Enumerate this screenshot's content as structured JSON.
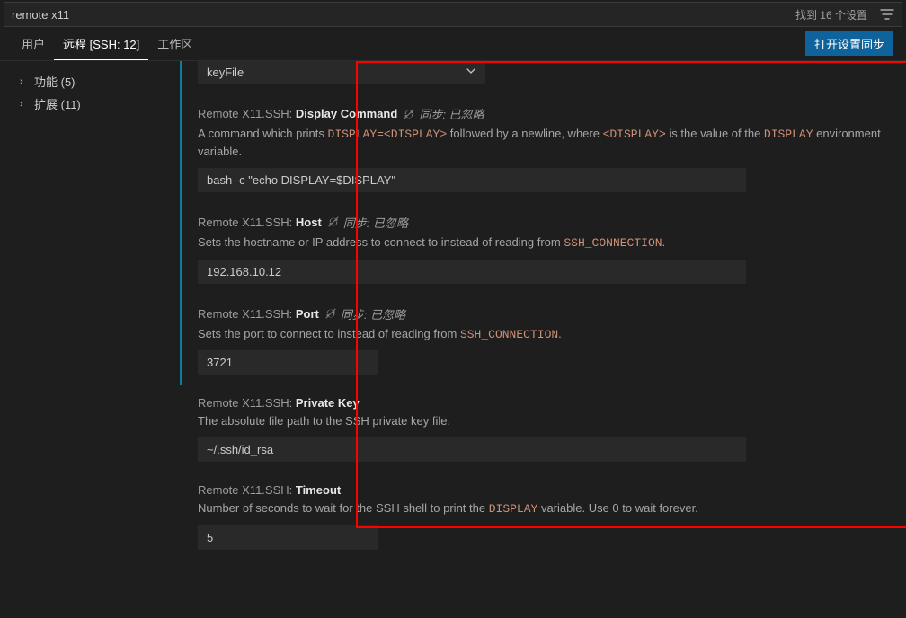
{
  "search": {
    "value": "remote x11",
    "count_text": "找到 16 个设置"
  },
  "tabs": {
    "user": "用户",
    "remote": "远程 [SSH: 12]",
    "workspace": "工作区"
  },
  "sync_button": "打开设置同步",
  "sidebar": {
    "items": [
      {
        "label": "功能 (5)"
      },
      {
        "label": "扩展 (11)"
      }
    ]
  },
  "sync_ignored_label": "同步: 已忽略",
  "settings": {
    "top_select_value": "keyFile",
    "display_command": {
      "prefix": "Remote X11.SSH:",
      "name": "Display Command",
      "desc_a": "A command which prints ",
      "code_a": "DISPLAY=<DISPLAY>",
      "desc_b": " followed by a newline, where ",
      "code_b": "<DISPLAY>",
      "desc_c": " is the value of the ",
      "code_c": "DISPLAY",
      "desc_d": " environment variable.",
      "value": "bash -c \"echo DISPLAY=$DISPLAY\""
    },
    "host": {
      "prefix": "Remote X11.SSH:",
      "name": "Host",
      "desc_a": "Sets the hostname or IP address to connect to instead of reading from ",
      "code_a": "SSH_CONNECTION",
      "desc_b": ".",
      "value": "192.168.10.12"
    },
    "port": {
      "prefix": "Remote X11.SSH:",
      "name": "Port",
      "desc_a": "Sets the port to connect to instead of reading from ",
      "code_a": "SSH_CONNECTION",
      "desc_b": ".",
      "value": "3721"
    },
    "private_key": {
      "prefix": "Remote X11.SSH:",
      "name": "Private Key",
      "desc": "The absolute file path to the SSH private key file.",
      "value": "~/.ssh/id_rsa"
    },
    "timeout": {
      "prefix": "Remote X11.SSH:",
      "name": "Timeout",
      "desc_a": "Number of seconds to wait for the SSH shell to print the ",
      "code_a": "DISPLAY",
      "desc_b": " variable. Use 0 to wait forever.",
      "value": "5"
    }
  }
}
